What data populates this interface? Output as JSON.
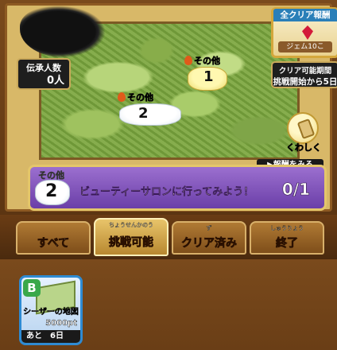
{
  "header": {
    "counter": {
      "label": "伝承人数",
      "value": "0人"
    },
    "reward": {
      "title": "全クリア報酬",
      "icon": "red-gem-icon",
      "desc": "ジェム10こ"
    },
    "period": {
      "title": "クリア可能期間",
      "value": "挑戦開始から5日"
    }
  },
  "map": {
    "markers": [
      {
        "category": "その他",
        "number": "1",
        "highlighted": true
      },
      {
        "category": "その他",
        "number": "2",
        "highlighted": false
      }
    ],
    "detail_button": {
      "label": "くわしく",
      "icon": "scroll-icon"
    },
    "reward_link": "▶報酬をみる"
  },
  "mission": {
    "category": "その他",
    "number": "2",
    "text": "ビューティーサロンに行ってみよう！",
    "progress": "0/1"
  },
  "tabs": [
    {
      "ruby": "",
      "label": "すべて",
      "active": false
    },
    {
      "ruby": "ちょうせんかのう",
      "label": "挑戦可能",
      "active": true
    },
    {
      "ruby": "ず",
      "label": "クリア済み",
      "active": false
    },
    {
      "ruby": "しゅうりょう",
      "label": "終了",
      "active": false
    }
  ],
  "items": [
    {
      "grade": "B",
      "name": "シーザーの地図",
      "cost": "5000pt",
      "remaining": "あと　6日",
      "grade_color": "#3aa84a"
    }
  ],
  "colors": {
    "mission_bg": "#7e52bb",
    "active_tab": "#e8c46a",
    "card_border": "#2e8bd3"
  }
}
